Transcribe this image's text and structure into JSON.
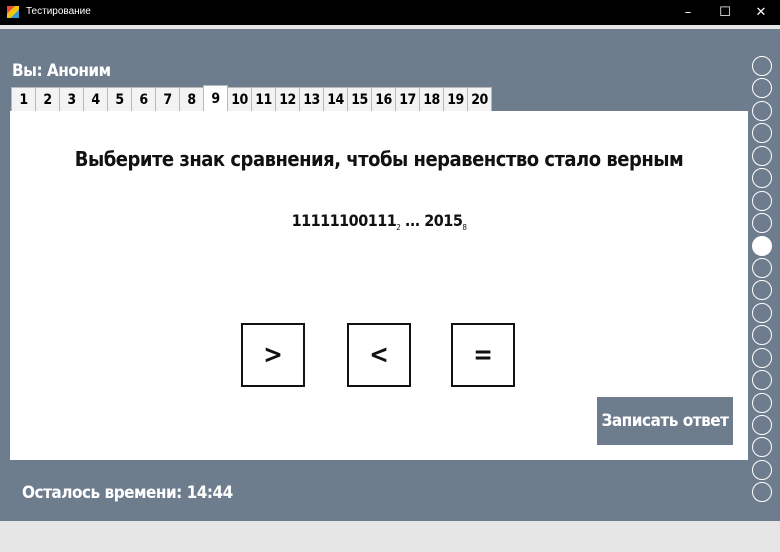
{
  "window": {
    "title": "Тестирование",
    "controls": {
      "minimize": "–",
      "maximize": "☐",
      "close": "✕"
    }
  },
  "user_label": "Вы: Аноним",
  "tabs": [
    "1",
    "2",
    "3",
    "4",
    "5",
    "6",
    "7",
    "8",
    "9",
    "10",
    "11",
    "12",
    "13",
    "14",
    "15",
    "16",
    "17",
    "18",
    "19",
    "20"
  ],
  "active_tab": "9",
  "question": {
    "text": "Выберите знак сравнения, чтобы неравенство стало верным",
    "left_number": "11111100111",
    "left_base": "2",
    "ellipsis": "...",
    "right_number": "2015",
    "right_base": "8"
  },
  "answers": [
    ">",
    "<",
    "="
  ],
  "submit_label": "Записать ответ",
  "timer": "Осталось времени: 14:44",
  "progress": {
    "total": 20,
    "current": 9
  },
  "colors": {
    "background": "#6e7d8e",
    "titlebar": "#000000",
    "panel": "#ffffff"
  }
}
